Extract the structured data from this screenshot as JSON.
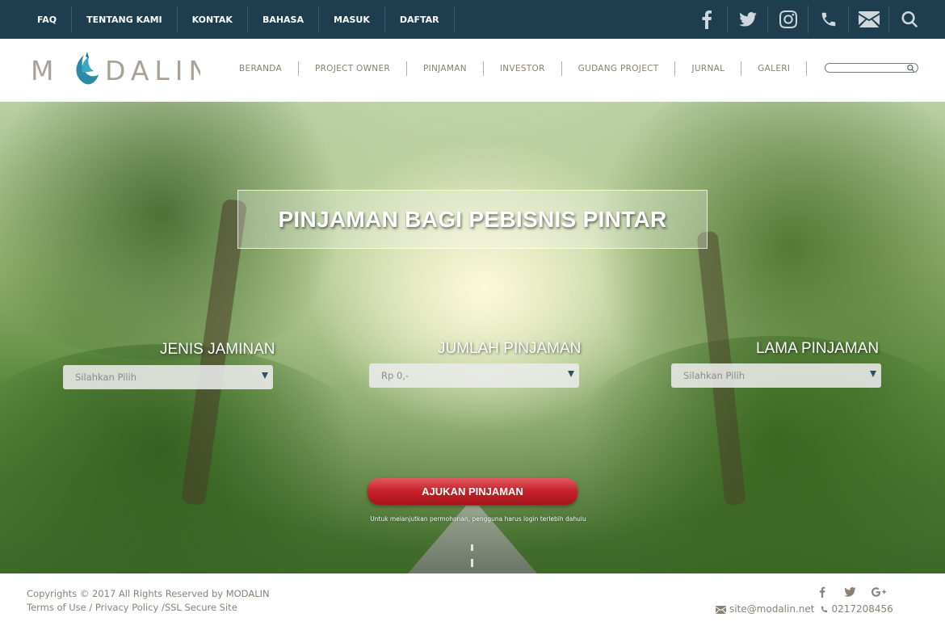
{
  "topbar": {
    "links": [
      "FAQ",
      "TENTANG KAMI",
      "KONTAK",
      "BAHASA",
      "MASUK",
      "DAFTAR"
    ],
    "icons": [
      "facebook-icon",
      "twitter-icon",
      "instagram-icon",
      "phone-icon",
      "mail-icon",
      "search-icon"
    ]
  },
  "navbar": {
    "logo": "MODALIN",
    "menu": [
      "BERANDA",
      "PROJECT OWNER",
      "PINJAMAN",
      "INVESTOR",
      "GUDANG PROJECT",
      "JURNAL",
      "GALERI"
    ]
  },
  "hero": {
    "title": "PINJAMAN BAGI PEBISNIS PINTAR",
    "fields": [
      {
        "label": "JENIS JAMINAN",
        "value": "Silahkan Pilih"
      },
      {
        "label": "JUMLAH PINJAMAN",
        "value": "Rp 0,-"
      },
      {
        "label": "LAMA PINJAMAN",
        "value": "Silahkan Pilih"
      }
    ],
    "submit": "AJUKAN PINJAMAN",
    "note": "Untuk melanjutkan permohonan, pengguna harus login terlebih dahulu"
  },
  "footer": {
    "copyright": "Copyrights © 2017 All Rights Reserved by MODALIN",
    "links_line": "Terms of Use / Privacy Policy /SSL Secure Site",
    "email": "site@modalin.net",
    "phone": "0217208456",
    "social": [
      "facebook-icon",
      "twitter-icon",
      "google-plus-icon"
    ]
  },
  "colors": {
    "topbar": "#1e3e4f",
    "accent_red": "#c71f28",
    "nav_text": "#8a7f72"
  }
}
